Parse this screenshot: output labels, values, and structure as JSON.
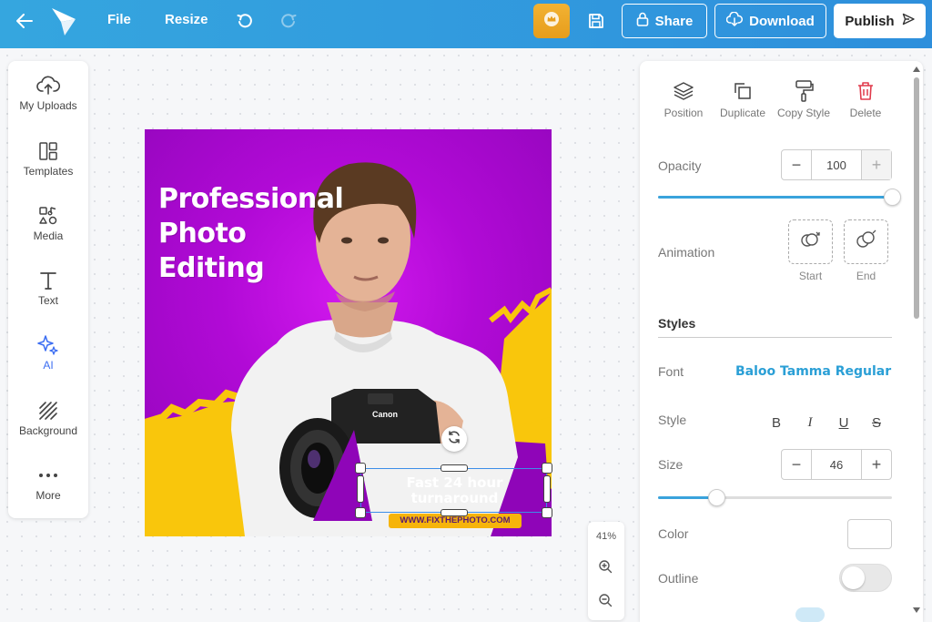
{
  "topbar": {
    "file_label": "File",
    "resize_label": "Resize",
    "share_label": "Share",
    "download_label": "Download",
    "publish_label": "Publish"
  },
  "leftbar": {
    "items": [
      {
        "label": "My Uploads",
        "icon": "cloud-upload-icon"
      },
      {
        "label": "Templates",
        "icon": "templates-icon"
      },
      {
        "label": "Media",
        "icon": "media-icon"
      },
      {
        "label": "Text",
        "icon": "text-icon"
      },
      {
        "label": "AI",
        "icon": "sparkle-icon"
      },
      {
        "label": "Background",
        "icon": "background-icon"
      },
      {
        "label": "More",
        "icon": "more-icon"
      }
    ]
  },
  "design": {
    "headline": "Professional\nPhoto\nEditing",
    "tagline": "Fast 24 hour\nturnaround",
    "url": "WWW.FIXTHEPHOTO.COM",
    "camera_brand": "Canon"
  },
  "zoom": {
    "level": "41%"
  },
  "panel": {
    "actions": [
      {
        "label": "Position",
        "icon": "layers-icon"
      },
      {
        "label": "Duplicate",
        "icon": "duplicate-icon"
      },
      {
        "label": "Copy Style",
        "icon": "paint-roller-icon"
      },
      {
        "label": "Delete",
        "icon": "trash-icon"
      }
    ],
    "opacity_label": "Opacity",
    "opacity_value": "100",
    "opacity_fraction": 1.0,
    "animation_label": "Animation",
    "anim_start_label": "Start",
    "anim_end_label": "End",
    "styles_label": "Styles",
    "font_label": "Font",
    "font_value": "Baloo Tamma Regular",
    "style_label": "Style",
    "style_buttons": [
      "B",
      "I",
      "U",
      "S"
    ],
    "size_label": "Size",
    "size_value": "46",
    "size_fraction": 0.25,
    "color_label": "Color",
    "color_value": "#ffffff",
    "outline_label": "Outline",
    "outline_on": false
  },
  "colors": {
    "topbar": "#2e9ade",
    "accent": "#3aa3dc",
    "design_bg": "#b10ad6",
    "design_yellow": "#f9c60c",
    "delete": "#e03a4b",
    "ai": "#3b6df2"
  }
}
